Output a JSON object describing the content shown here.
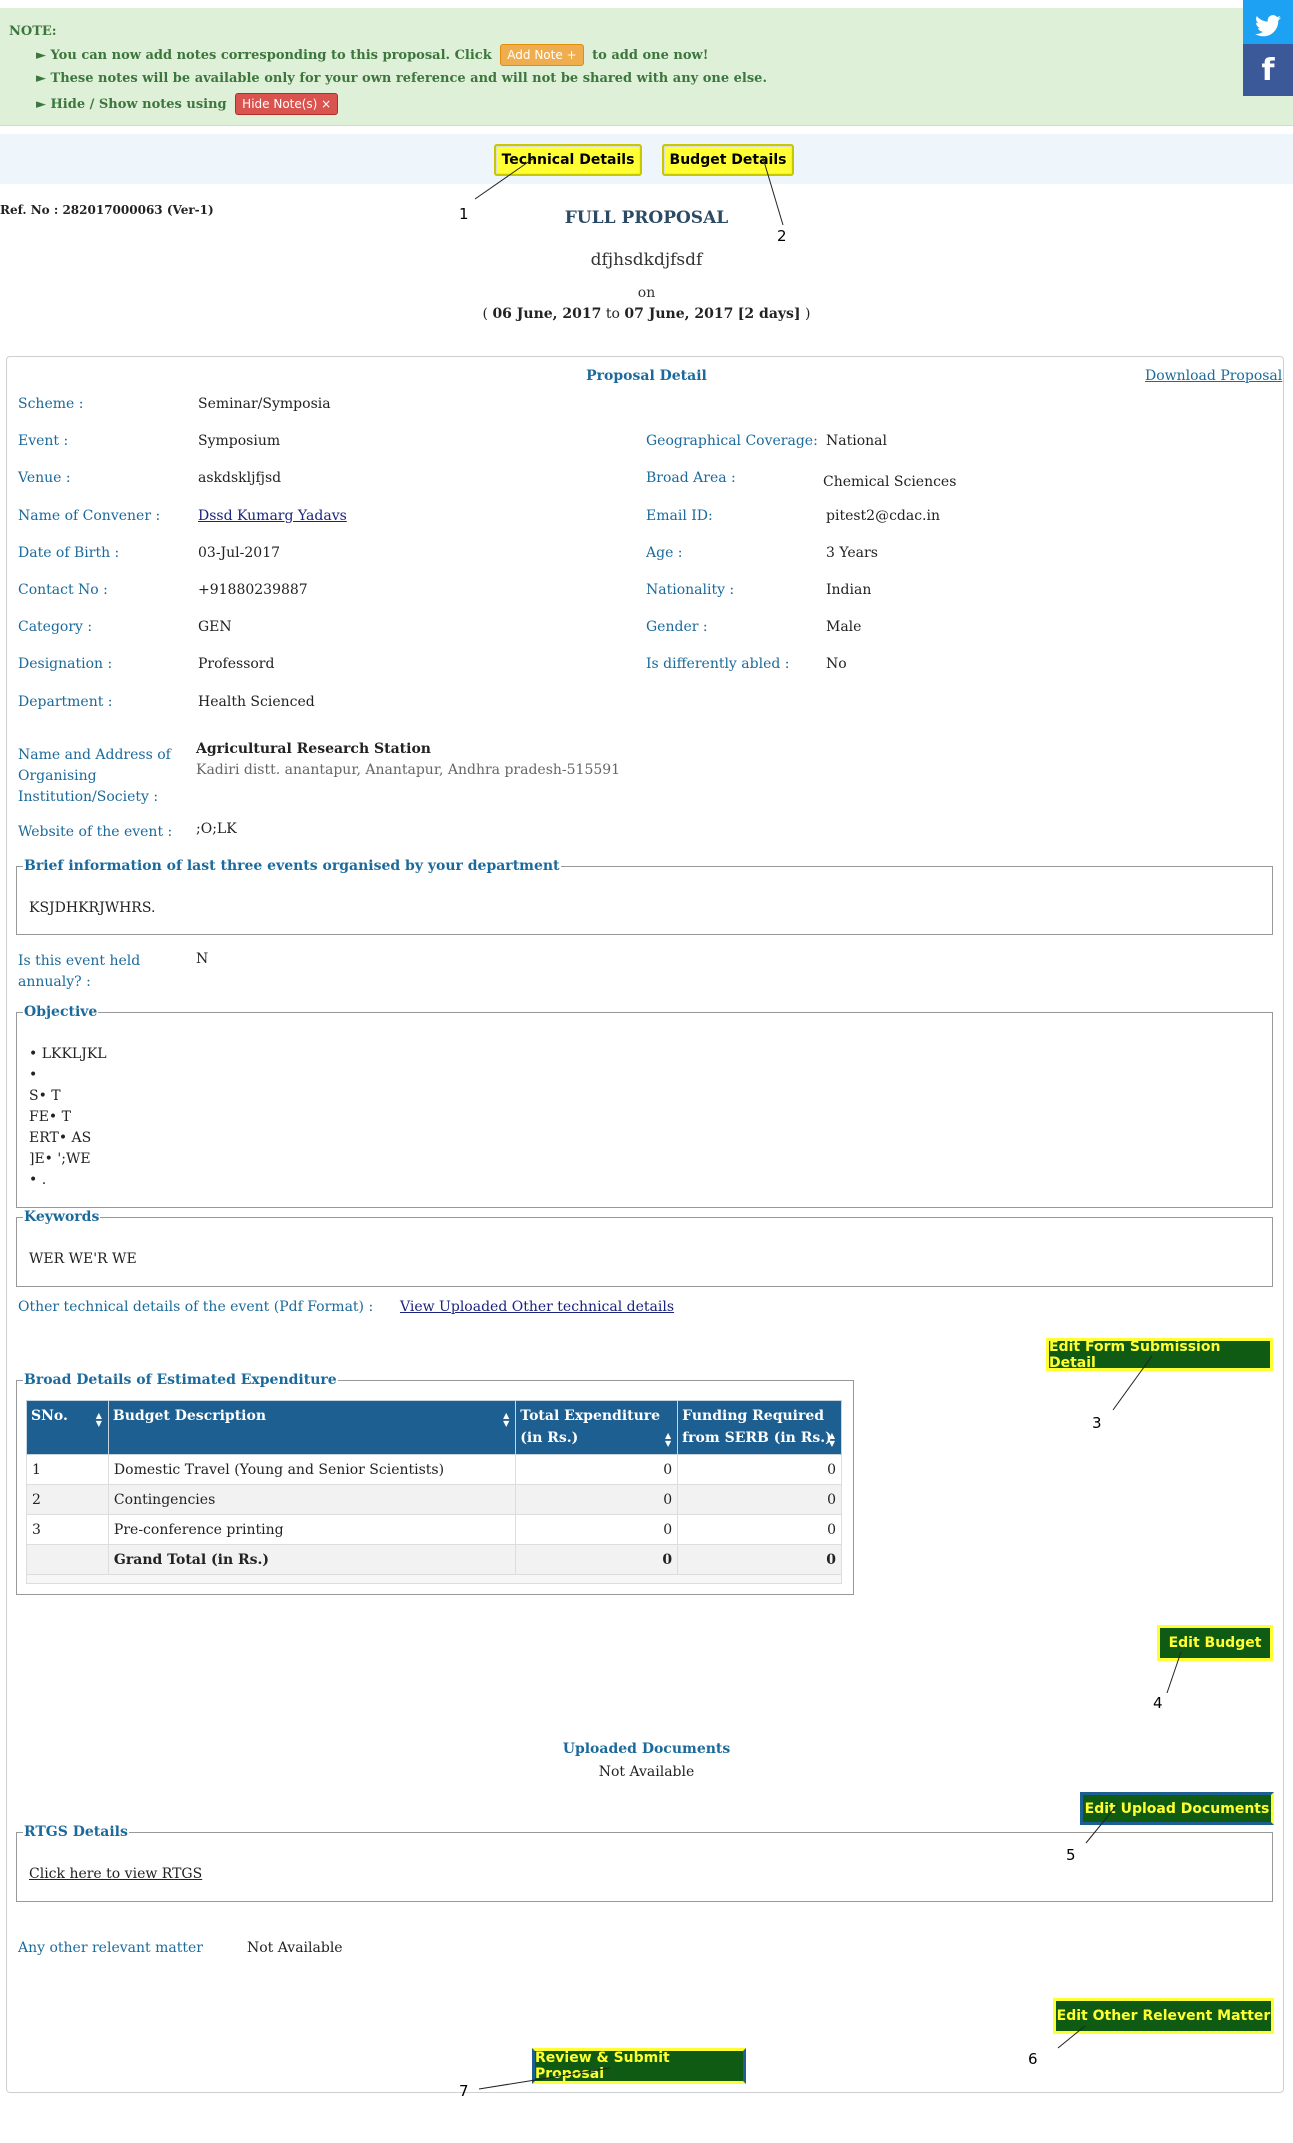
{
  "note": {
    "title": "NOTE:",
    "line1_prefix": "► You can now add notes corresponding to this proposal. Click",
    "add_note_label": "Add Note +",
    "line1_suffix": "to add one now!",
    "line2": "► These notes will be available only for your own reference and will not be shared with any one else.",
    "line3_prefix": "► Hide / Show notes using",
    "hide_note_label": "Hide Note(s) ×"
  },
  "social": {
    "twitter_icon": "twitter-bird",
    "facebook_label": "f"
  },
  "tabs": {
    "technical": "Technical Details",
    "budget": "Budget Details"
  },
  "header": {
    "ref_no": "Ref. No : 282017000063 (Ver-1)",
    "page_title": "FULL PROPOSAL",
    "proposal_title": "dfjhsdkdjfsdf",
    "on": "on",
    "date_open": "(",
    "date_from": "06 June, 2017",
    "date_to_word": "to",
    "date_to": "07 June, 2017",
    "date_days": "[2 days]",
    "date_close": ")"
  },
  "detail": {
    "heading": "Proposal Detail",
    "download_link": "Download Proposal",
    "left": [
      {
        "label": "Scheme :",
        "value": "Seminar/Symposia"
      },
      {
        "label": "Event :",
        "value": "Symposium"
      },
      {
        "label": "Venue :",
        "value": "askdskljfjsd"
      },
      {
        "label": "Name of Convener :",
        "value": "Dssd Kumarg Yadavs"
      },
      {
        "label": "Date of Birth :",
        "value": "03-Jul-2017"
      },
      {
        "label": "Contact No :",
        "value": "+91880239887"
      },
      {
        "label": "Category :",
        "value": "GEN"
      },
      {
        "label": "Designation :",
        "value": "Professord"
      },
      {
        "label": "Department :",
        "value": "Health Scienced"
      }
    ],
    "right": [
      {
        "label": "Geographical Coverage:",
        "value": "National"
      },
      {
        "label": "Broad Area :",
        "value": "Chemical Sciences"
      },
      {
        "label": "Email ID:",
        "value": "pitest2@cdac.in"
      },
      {
        "label": "Age :",
        "value": "3 Years"
      },
      {
        "label": "Nationality :",
        "value": "Indian"
      },
      {
        "label": "Gender :",
        "value": "Male"
      },
      {
        "label": "Is differently abled :",
        "value": "No"
      }
    ],
    "institution_label": "Name and Address of Organising Institution/Society :",
    "institution_name": "Agricultural Research Station",
    "institution_address": "Kadiri distt. anantapur, Anantapur, Andhra pradesh-515591",
    "website_label": "Website of the event :",
    "website_value": ";O;LK"
  },
  "brief": {
    "legend": "Brief information of last three events organised by your department",
    "text": "KSJDHKRJWHRS."
  },
  "annual": {
    "label": "Is this event held annualy? :",
    "value": "N"
  },
  "objective": {
    "legend": "Objective",
    "lines": [
      "• LKKLJKL",
      "•",
      "S• T",
      "FE• T",
      "ERT• AS",
      "]E• ';WE",
      "• ."
    ]
  },
  "keywords": {
    "legend": "Keywords",
    "text": "WER WE'R WE"
  },
  "other_tech": {
    "label": "Other technical details of the event (Pdf Format) :",
    "link": "View Uploaded Other technical details"
  },
  "buttons": {
    "edit_form": "Edit Form Submission Detail",
    "edit_budget": "Edit Budget",
    "edit_upload": "Edit Upload Documents",
    "edit_other": "Edit Other Relevent Matter",
    "review_submit": "Review & Submit Proposal"
  },
  "budget": {
    "legend": "Broad Details of Estimated Expenditure",
    "headers": [
      "SNo.",
      "Budget Description",
      "Total Expenditure (in Rs.)",
      "Funding Required from SERB (in Rs.)"
    ],
    "rows": [
      {
        "sno": "1",
        "desc": "Domestic Travel (Young and Senior Scientists)",
        "total": "0",
        "serb": "0"
      },
      {
        "sno": "2",
        "desc": "Contingencies",
        "total": "0",
        "serb": "0"
      },
      {
        "sno": "3",
        "desc": "Pre-conference printing",
        "total": "0",
        "serb": "0"
      }
    ],
    "total_row": {
      "desc": "Grand Total (in Rs.)",
      "total": "0",
      "serb": "0"
    }
  },
  "uploaded": {
    "heading": "Uploaded Documents",
    "value": "Not Available"
  },
  "rtgs": {
    "legend": "RTGS Details",
    "link": "Click here to view RTGS"
  },
  "other_matter": {
    "label": "Any other relevant matter",
    "value": "Not Available"
  },
  "callouts": [
    "1",
    "2",
    "3",
    "4",
    "5",
    "6",
    "7"
  ],
  "colors": {
    "accent": "#1b6a9b",
    "highlight": "#ffff33",
    "green_button": "#0f5b13",
    "table_header": "#1d5f91"
  }
}
